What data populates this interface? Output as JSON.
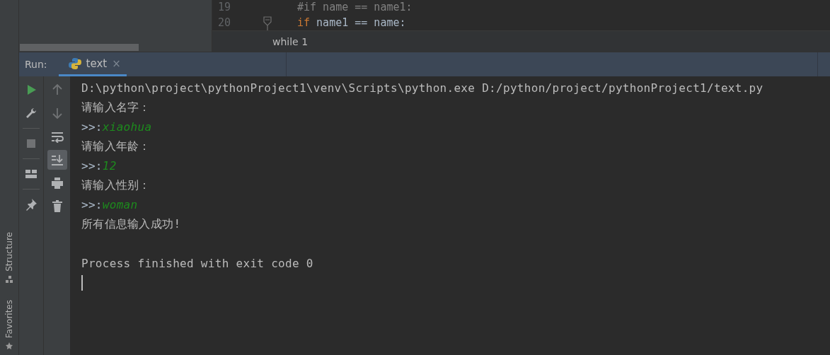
{
  "editor": {
    "lines": [
      {
        "number": "19",
        "tokens": [
          {
            "kind": "comment",
            "text": "#if name == name1:"
          }
        ],
        "fold": false
      },
      {
        "number": "20",
        "tokens": [
          {
            "kind": "keyword",
            "text": "if"
          },
          {
            "kind": "plain",
            "text": " name1 == name:"
          }
        ],
        "fold": true
      }
    ]
  },
  "breadcrumb": "while 1",
  "run_bar": {
    "label": "Run:",
    "tabs": [
      {
        "label": "text",
        "selected": true,
        "close": "×"
      }
    ]
  },
  "toolbar_main": [
    {
      "kind": "run",
      "disabled": false
    },
    {
      "kind": "wrench",
      "disabled": false
    },
    {
      "kind": "separator"
    },
    {
      "kind": "stop",
      "disabled": true
    },
    {
      "kind": "separator"
    },
    {
      "kind": "layout",
      "disabled": false
    },
    {
      "kind": "separator"
    },
    {
      "kind": "pin",
      "disabled": false
    }
  ],
  "toolbar_side": [
    {
      "kind": "up",
      "disabled": true,
      "on": false
    },
    {
      "kind": "down",
      "disabled": true,
      "on": false
    },
    {
      "kind": "wrap",
      "disabled": false,
      "on": false
    },
    {
      "kind": "scroll-end",
      "disabled": false,
      "on": true
    },
    {
      "kind": "print",
      "disabled": false,
      "on": false
    },
    {
      "kind": "trash",
      "disabled": false,
      "on": false
    }
  ],
  "console": [
    {
      "kind": "text",
      "text": "D:\\python\\project\\pythonProject1\\venv\\Scripts\\python.exe D:/python/project/pythonProject1/text.py"
    },
    {
      "kind": "text",
      "text": "请输入名字："
    },
    {
      "kind": "input",
      "prompt": ">>:",
      "value": "xiaohua"
    },
    {
      "kind": "text",
      "text": "请输入年龄："
    },
    {
      "kind": "input",
      "prompt": ">>:",
      "value": "12"
    },
    {
      "kind": "text",
      "text": "请输入性别："
    },
    {
      "kind": "input",
      "prompt": ">>:",
      "value": "woman"
    },
    {
      "kind": "text",
      "text": "所有信息输入成功!"
    },
    {
      "kind": "blank"
    },
    {
      "kind": "text",
      "text": "Process finished with exit code 0"
    },
    {
      "kind": "cursor"
    }
  ],
  "side_stripe": [
    {
      "label": "Structure",
      "kind": "structure"
    },
    {
      "label": "Favorites",
      "kind": "favorites"
    }
  ]
}
